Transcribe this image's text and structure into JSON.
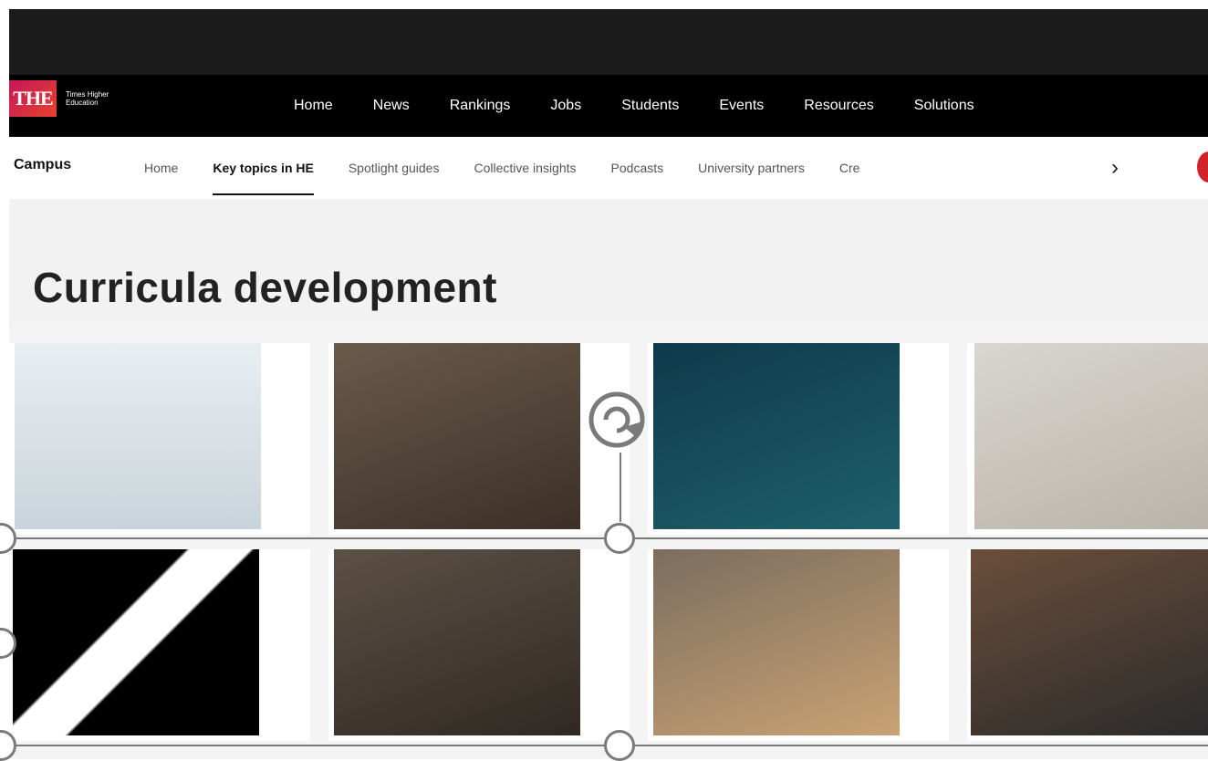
{
  "header": {
    "logo_text": "THE",
    "logo_subtitle": "Times Higher Education",
    "nav": [
      "Home",
      "News",
      "Rankings",
      "Jobs",
      "Students",
      "Events",
      "Resources",
      "Solutions"
    ]
  },
  "subnav": {
    "brand": "Campus",
    "items": [
      "Home",
      "Key topics in HE",
      "Spotlight guides",
      "Collective insights",
      "Podcasts",
      "University partners",
      "Cre"
    ],
    "active": "Key topics in HE"
  },
  "page": {
    "title": "Curricula development"
  },
  "images": [
    {
      "icon": "student-walking-photo"
    },
    {
      "icon": "team-globe-photo"
    },
    {
      "icon": "speaker-microphone-photo"
    },
    {
      "icon": "sticky-note-laptop-photo"
    },
    {
      "icon": "piano-hand-photo"
    },
    {
      "icon": "team-globe-photo-2"
    },
    {
      "icon": "meeting-room-photo"
    },
    {
      "icon": "mentor-student-photo"
    }
  ]
}
